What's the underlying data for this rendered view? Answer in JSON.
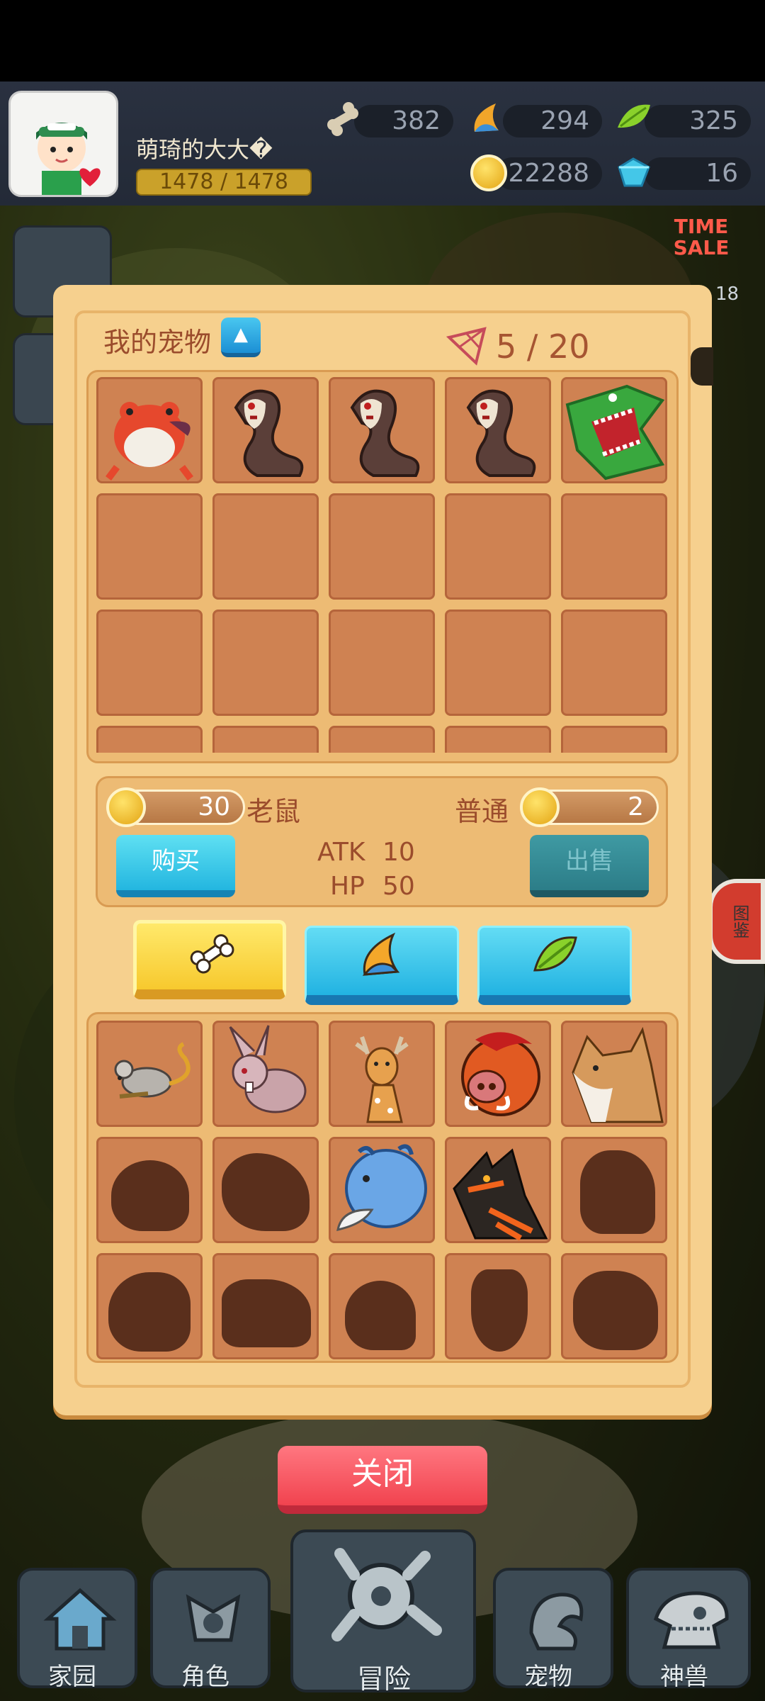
{
  "player": {
    "name": "萌琦的大大�",
    "level_text": "1478 / 1478"
  },
  "resources": {
    "bone": "382",
    "horn": "294",
    "leaf": "325",
    "coin": "22288",
    "gem": "16"
  },
  "side": {
    "time_sale": "TIME\nSALE",
    "timer_fragment": "18",
    "catalog": "图鉴"
  },
  "panel": {
    "title": "我的宠物",
    "up_glyph": "▲",
    "count": "5 / 20"
  },
  "my_pets": [
    "frog",
    "cobra",
    "cobra",
    "cobra",
    "crocodile"
  ],
  "detail": {
    "buy_price": "30",
    "pet_name": "老鼠",
    "rarity": "普通",
    "sell_price": "2",
    "buy_label": "购买",
    "sell_label": "出售",
    "atk_label": "ATK",
    "atk_value": "10",
    "hp_label": "HP",
    "hp_value": "50"
  },
  "tabs": [
    {
      "icon": "bone-icon",
      "active": true
    },
    {
      "icon": "horn-icon",
      "active": false
    },
    {
      "icon": "leaf-icon",
      "active": false
    }
  ],
  "shop_pets": [
    "mouse",
    "rabbit",
    "deer",
    "boar",
    "fox",
    "locked",
    "locked",
    "rhino",
    "wolf",
    "locked",
    "locked",
    "locked",
    "locked",
    "locked",
    "locked"
  ],
  "close_label": "关闭",
  "nav": [
    {
      "label": "家园",
      "icon": "home-icon"
    },
    {
      "label": "角色",
      "icon": "character-icon"
    },
    {
      "label": "冒险",
      "icon": "adventure-icon"
    },
    {
      "label": "宠物",
      "icon": "pet-icon"
    },
    {
      "label": "神兽",
      "icon": "beast-icon"
    }
  ],
  "colors": {
    "panel": "#f6d08e",
    "slot": "#cf8252",
    "accent_blue": "#23b6e0",
    "close_red": "#f1434f"
  }
}
